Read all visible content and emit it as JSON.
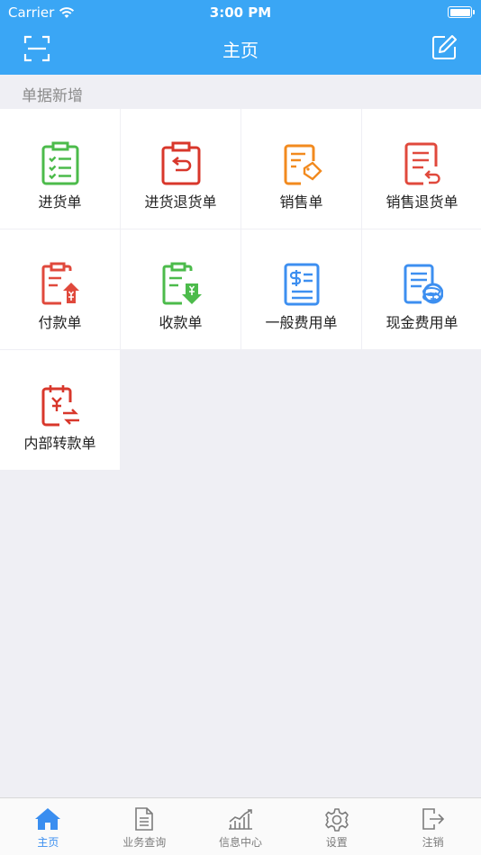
{
  "status_bar": {
    "carrier": "Carrier",
    "time": "3:00 PM"
  },
  "nav": {
    "title": "主页",
    "left_icon": "scan-icon",
    "right_icon": "edit-icon"
  },
  "section": {
    "title": "单据新增"
  },
  "grid_items": [
    {
      "label": "进货单",
      "icon": "purchase-order-icon",
      "color": "#4cbb4b"
    },
    {
      "label": "进货退货单",
      "icon": "purchase-return-icon",
      "color": "#d8372b"
    },
    {
      "label": "销售单",
      "icon": "sales-order-icon",
      "color": "#f28a1e"
    },
    {
      "label": "销售退货单",
      "icon": "sales-return-icon",
      "color": "#e0493c"
    },
    {
      "label": "付款单",
      "icon": "payment-icon",
      "color": "#e0493c"
    },
    {
      "label": "收款单",
      "icon": "receipt-icon",
      "color": "#4cbb4b"
    },
    {
      "label": "一般费用单",
      "icon": "general-expense-icon",
      "color": "#3d8ff0"
    },
    {
      "label": "现金费用单",
      "icon": "cash-expense-icon",
      "color": "#3d8ff0"
    },
    {
      "label": "内部转款单",
      "icon": "internal-transfer-icon",
      "color": "#d8372b"
    }
  ],
  "tabs": [
    {
      "label": "主页",
      "icon": "home-icon",
      "active": true
    },
    {
      "label": "业务查询",
      "icon": "document-icon",
      "active": false
    },
    {
      "label": "信息中心",
      "icon": "chart-icon",
      "active": false
    },
    {
      "label": "设置",
      "icon": "gear-icon",
      "active": false
    },
    {
      "label": "注销",
      "icon": "logout-icon",
      "active": false
    }
  ],
  "colors": {
    "header": "#3aa6f5",
    "accent": "#3a8ef0",
    "background": "#efeff4"
  }
}
